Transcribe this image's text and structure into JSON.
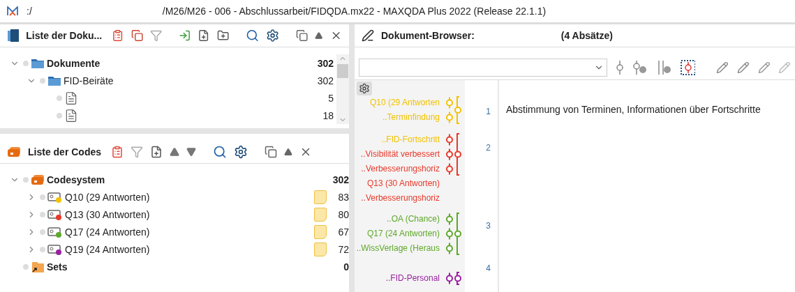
{
  "window": {
    "path_start": ":/",
    "title": "/M26/M26 - 006 - Abschlussarbeit/FIDQDA.mx22 - MAXQDA Plus 2022 (Release 22.1.1)"
  },
  "documents_panel": {
    "title": "Liste der Doku...",
    "tree": [
      {
        "kind": "root",
        "label": "Dokumente",
        "count": "302",
        "expanded": true,
        "children": [
          {
            "kind": "folder",
            "label": "FID-Beiräte",
            "count": "302",
            "expanded": true,
            "children": [
              {
                "kind": "document",
                "count": "5"
              },
              {
                "kind": "document",
                "count": "18"
              }
            ]
          }
        ]
      }
    ]
  },
  "codes_panel": {
    "title": "Liste der Codes",
    "tree": [
      {
        "kind": "root",
        "label": "Codesystem",
        "count": "302",
        "expanded": true,
        "children": [
          {
            "kind": "code",
            "label": "Q10 (29 Antworten)",
            "color": "#f2c200",
            "count": "83",
            "expanded": false,
            "memo": true
          },
          {
            "kind": "code",
            "label": "Q13 (30 Antworten)",
            "color": "#e8392a",
            "count": "80",
            "expanded": false,
            "memo": true
          },
          {
            "kind": "code",
            "label": "Q17 (24 Antworten)",
            "color": "#5ea82a",
            "count": "67",
            "expanded": false,
            "memo": true
          },
          {
            "kind": "code",
            "label": "Q19 (24 Antworten)",
            "color": "#9a1fa0",
            "count": "72",
            "expanded": false,
            "memo": true
          }
        ]
      },
      {
        "kind": "sets",
        "label": "Sets",
        "count": "0"
      }
    ]
  },
  "document_browser": {
    "title": "Dokument-Browser:",
    "paragraph_count": "(4 Absätze)",
    "paragraphs": [
      {
        "number": "1",
        "text": "Abstimmung von Terminen, Informationen über Fortschritte",
        "color": "#f2c200",
        "codes": [
          {
            "label": "Q10 (29 Antworten",
            "color": "#f2c200"
          },
          {
            "label": "..Terminfindung",
            "color": "#f2c200"
          }
        ]
      },
      {
        "number": "2",
        "color": "#e8392a",
        "codes": [
          {
            "label": "..FID-Fortschritt",
            "color": "#f2c200"
          },
          {
            "label": "..Visibilität verbessert",
            "color": "#e8392a"
          },
          {
            "label": "..Verbesserungshoriz",
            "color": "#e8392a"
          },
          {
            "label": "Q13 (30 Antworten)",
            "color": "#e8392a"
          },
          {
            "label": "..Verbesserungshoriz",
            "color": "#e8392a"
          }
        ]
      },
      {
        "number": "3",
        "color": "#5ea82a",
        "codes": [
          {
            "label": "..OA (Chance)",
            "color": "#5ea82a"
          },
          {
            "label": "Q17 (24 Antworten)",
            "color": "#5ea82a"
          },
          {
            "label": "..WissVerlage (Heraus",
            "color": "#5ea82a"
          }
        ]
      },
      {
        "number": "4",
        "color": "#9a1fa0",
        "codes": [
          {
            "label": "..FID-Personal",
            "color": "#9a1fa0"
          }
        ]
      }
    ]
  }
}
